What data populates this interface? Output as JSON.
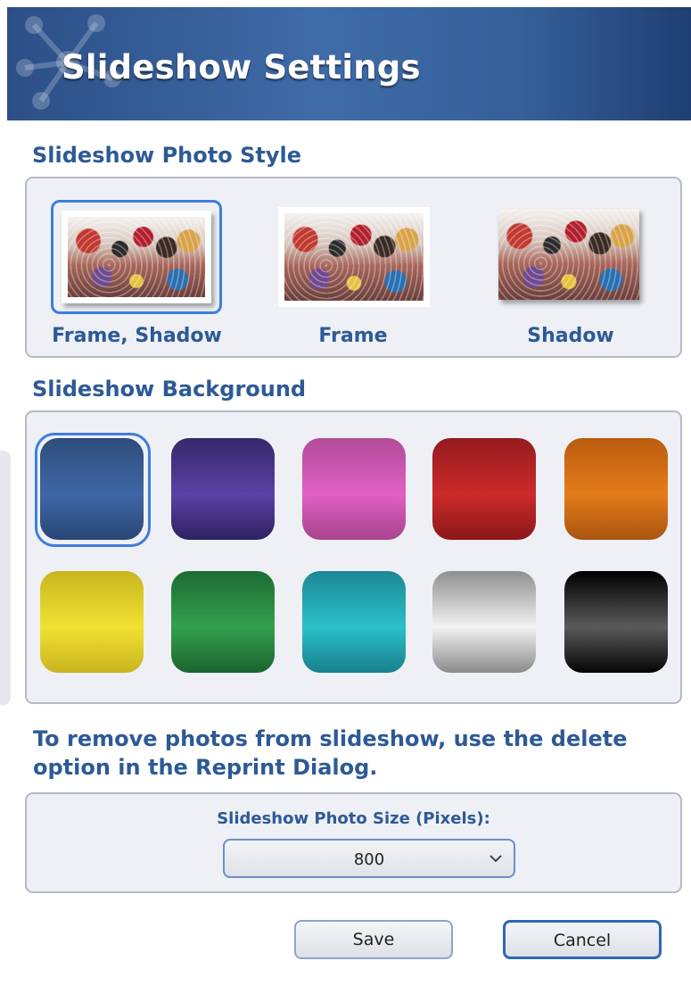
{
  "dialog": {
    "title": "Slideshow Settings",
    "accent": "#2d5a96"
  },
  "photo_style": {
    "heading": "Slideshow Photo Style",
    "options": [
      {
        "label": "Frame, Shadow",
        "selected": true
      },
      {
        "label": "Frame",
        "selected": false
      },
      {
        "label": "Shadow",
        "selected": false
      }
    ]
  },
  "background": {
    "heading": "Slideshow Background",
    "swatches": [
      {
        "name": "blue",
        "top": "#2e4d7c",
        "mid": "#3f67a6",
        "bottom": "#294675",
        "selected": true
      },
      {
        "name": "purple",
        "top": "#35286c",
        "mid": "#5a42a6",
        "bottom": "#2d2260",
        "selected": false
      },
      {
        "name": "pink",
        "top": "#b24c98",
        "mid": "#e05fc4",
        "bottom": "#a8448d",
        "selected": false
      },
      {
        "name": "red",
        "top": "#951b1e",
        "mid": "#cc2a2b",
        "bottom": "#8b1719",
        "selected": false
      },
      {
        "name": "orange",
        "top": "#b85c0f",
        "mid": "#e47c1a",
        "bottom": "#a9540f",
        "selected": false
      },
      {
        "name": "yellow",
        "top": "#c8b51f",
        "mid": "#f0e233",
        "bottom": "#c9b41f",
        "selected": false
      },
      {
        "name": "green",
        "top": "#1d6b33",
        "mid": "#33a04f",
        "bottom": "#1b632f",
        "selected": false
      },
      {
        "name": "teal",
        "top": "#1b8894",
        "mid": "#2bc0c9",
        "bottom": "#17808c",
        "selected": false
      },
      {
        "name": "silver",
        "top": "#8f8f8f",
        "mid": "#f2f2f2",
        "bottom": "#8a8a8a",
        "selected": false
      },
      {
        "name": "black",
        "top": "#000000",
        "mid": "#5a5a5a",
        "bottom": "#050505",
        "selected": false
      }
    ]
  },
  "note": "To remove photos from slideshow, use the delete option in the Reprint Dialog.",
  "photo_size": {
    "label": "Slideshow Photo Size (Pixels):",
    "value": "800"
  },
  "buttons": {
    "save": "Save",
    "cancel": "Cancel"
  }
}
